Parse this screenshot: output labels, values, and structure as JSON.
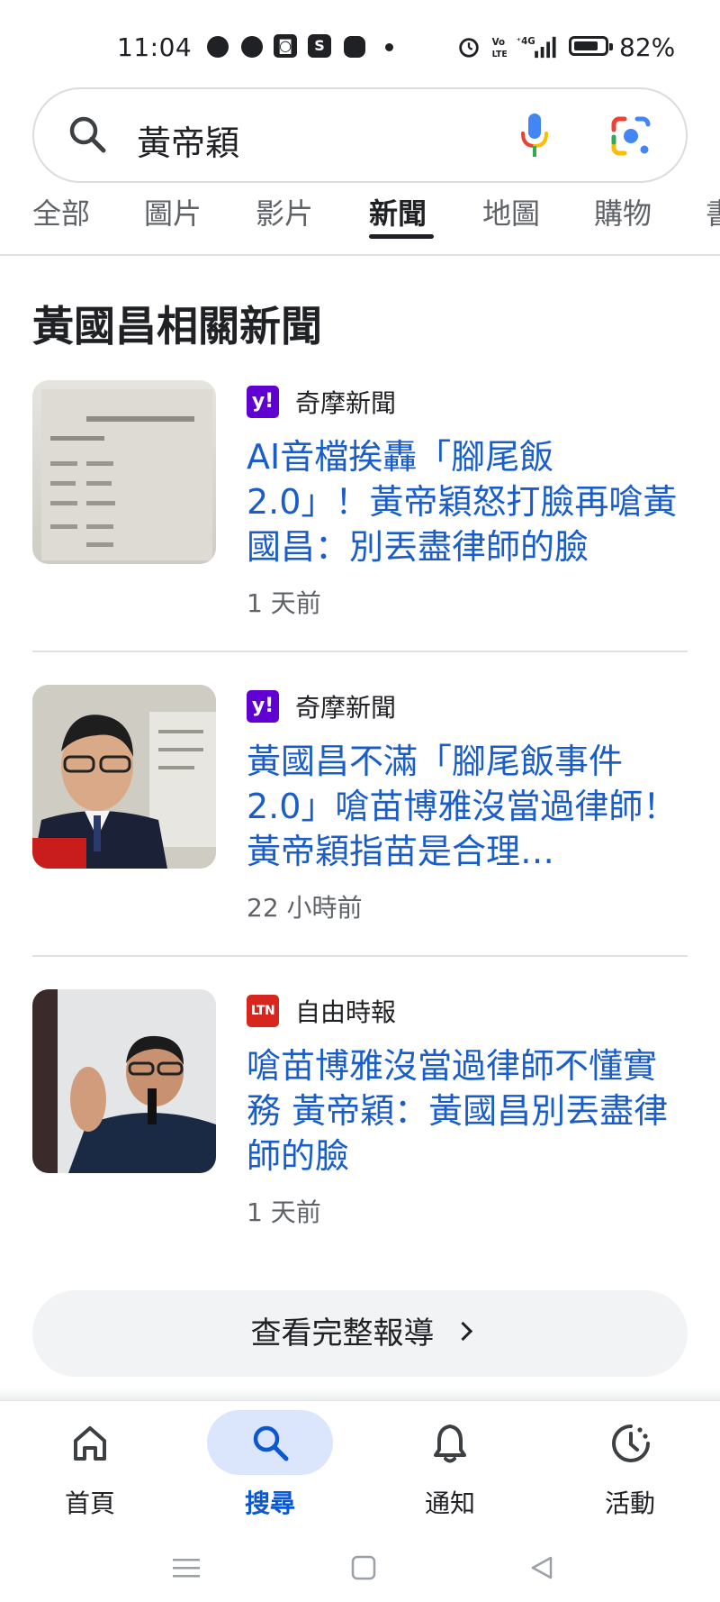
{
  "status_bar": {
    "time": "11:04",
    "app_icons": [
      "messenger-icon",
      "messenger-icon",
      "shopee-icon",
      "skype-icon",
      "line-icon"
    ],
    "system_icons": [
      "alarm-icon",
      "volte-icon",
      "4g-signal-icon",
      "battery-icon"
    ],
    "battery_percent": "82%",
    "battery_level": 0.82
  },
  "search": {
    "query": "黃帝穎",
    "icons": [
      "search-icon",
      "microphone-icon",
      "google-lens-icon"
    ]
  },
  "tabs": [
    {
      "label": "全部"
    },
    {
      "label": "圖片"
    },
    {
      "label": "影片"
    },
    {
      "label": "新聞",
      "active": true
    },
    {
      "label": "地圖"
    },
    {
      "label": "購物"
    },
    {
      "label": "書"
    }
  ],
  "section_title": "黃國昌相關新聞",
  "news": [
    {
      "source": "奇摩新聞",
      "source_logo_text": "y!",
      "source_color": "#6001d2",
      "headline": "AI音檔挨轟「腳尾飯 2.0」！黃帝穎怒打臉再嗆黃國昌：別丟盡律師的臉",
      "time": "1 天前"
    },
    {
      "source": "奇摩新聞",
      "source_logo_text": "y!",
      "source_color": "#6001d2",
      "headline": "黃國昌不滿「腳尾飯事件 2.0」嗆苗博雅沒當過律師！黃帝穎指苗是合理…",
      "time": "22 小時前"
    },
    {
      "source": "自由時報",
      "source_logo_text": "LTN",
      "source_color": "#d7261e",
      "headline": "嗆苗博雅沒當過律師不懂實務 黃帝穎：黃國昌別丟盡律師的臉",
      "time": "1 天前"
    }
  ],
  "more_button": "查看完整報導",
  "bottom_nav": [
    {
      "label": "首頁",
      "icon": "home-icon"
    },
    {
      "label": "搜尋",
      "icon": "search-icon",
      "active": true
    },
    {
      "label": "通知",
      "icon": "bell-icon"
    },
    {
      "label": "活動",
      "icon": "activity-icon"
    }
  ],
  "system_nav": [
    "menu-icon",
    "home-square-icon",
    "back-triangle-icon"
  ],
  "colors": {
    "link": "#1a5dc8",
    "nav_active": "#0b57d0",
    "nav_pill": "#dbe6fd",
    "mic_blue": "#4285f4",
    "mic_red": "#ea4335",
    "mic_yellow": "#fbbc04",
    "mic_green": "#34a853"
  }
}
